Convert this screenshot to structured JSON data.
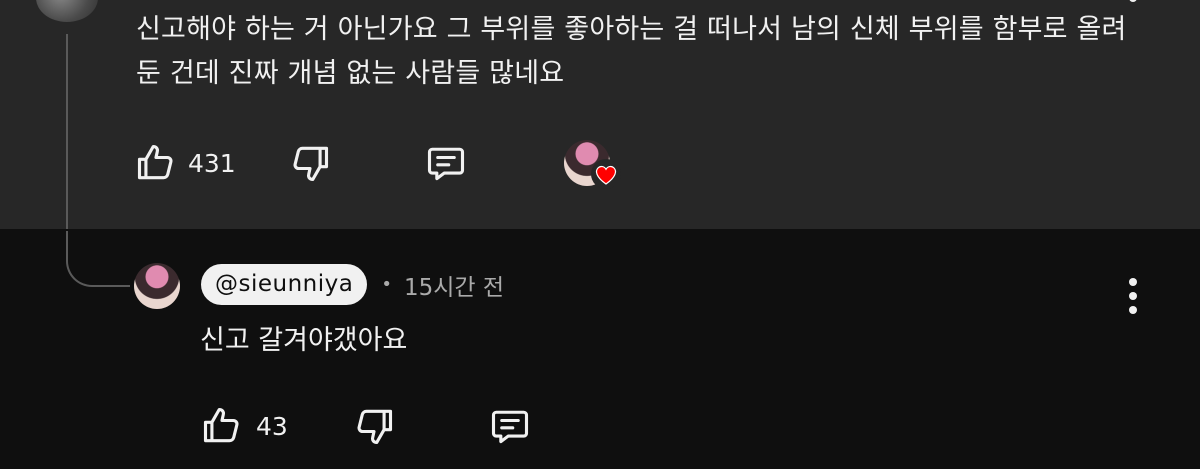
{
  "parent_comment": {
    "text": "신고해야 하는 거 아닌가요 그 부위를 좋아하는 걸 떠나서 남의 신체 부위를 함부로 올려둔 건데 진짜 개념 없는 사람들 많네요",
    "like_count": "431",
    "icons": {
      "like": "thumbs-up-icon",
      "dislike": "thumbs-down-icon",
      "reply": "reply-comment-icon",
      "creator_heart": "heart-icon"
    }
  },
  "reply": {
    "handle": "@sieunniya",
    "separator": "•",
    "timestamp": "15시간 전",
    "text": "신고 갈겨야갰아요",
    "like_count": "43"
  },
  "colors": {
    "parent_background": "#272727",
    "page_background": "#0f0f0f",
    "text_primary": "#f1f1f1",
    "text_secondary": "#aaaaaa",
    "heart": "#ff0000"
  }
}
